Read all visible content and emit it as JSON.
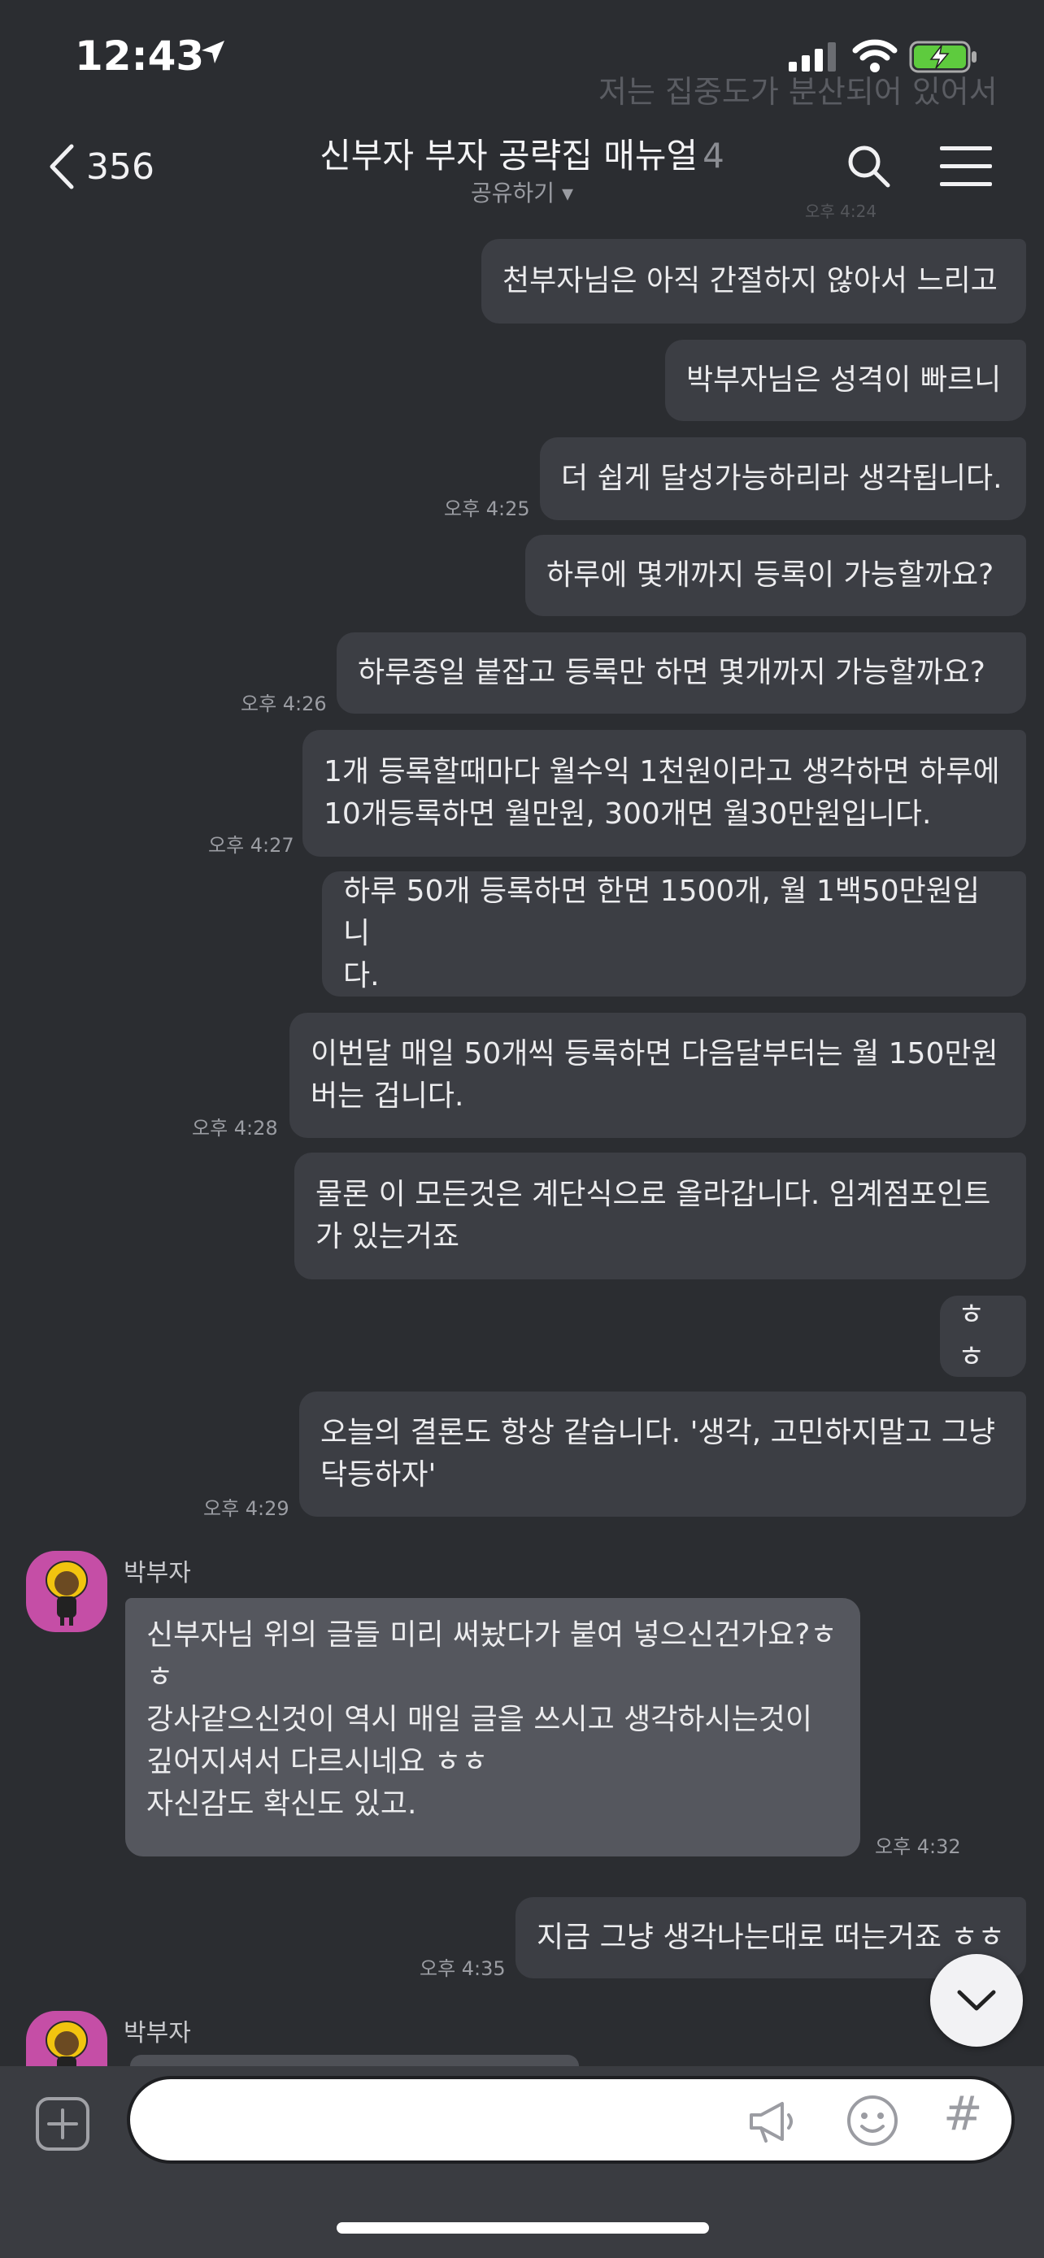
{
  "status": {
    "time": "12:43"
  },
  "ghost": {
    "text": "저는 집중도가 분산되어 있어서",
    "time": "오후 4:24"
  },
  "header": {
    "back_count": "356",
    "title": "신부자 부자 공략집 매뉴얼",
    "member_count": "4",
    "share_label": "공유하기 ▾"
  },
  "messages": [
    {
      "text": "천부자님은 아직 간절하지 않아서 느리고",
      "time": ""
    },
    {
      "text": "박부자님은 성격이 빠르니",
      "time": ""
    },
    {
      "text": "더 쉽게 달성가능하리라 생각됩니다.",
      "time": "오후 4:25"
    },
    {
      "text": "하루에 몇개까지 등록이 가능할까요?",
      "time": ""
    },
    {
      "text": "하루종일 붙잡고 등록만 하면 몇개까지 가능할까요?",
      "time": "오후 4:26"
    },
    {
      "text": "1개 등록할때마다 월수익 1천원이라고 생각하면 하루에\n10개등록하면 월만원, 300개면 월30만원입니다.",
      "time": "오후 4:27"
    },
    {
      "text": "하루 50개 등록하면 한면 1500개, 월 1백50만원입니\n다.",
      "time": ""
    },
    {
      "text": "이번달 매일 50개씩 등록하면 다음달부터는 월 150만원\n버는 겁니다.",
      "time": "오후 4:28"
    },
    {
      "text": "물론 이 모든것은 계단식으로 올라갑니다. 임계점포인트\n가 있는거죠",
      "time": ""
    },
    {
      "text": "ㅎㅎ",
      "time": ""
    },
    {
      "text": "오늘의 결론도 항상 같습니다. '생각, 고민하지말고 그냥\n닥등하자'",
      "time": "오후 4:29"
    }
  ],
  "incoming": {
    "sender": "박부자",
    "text": "신부자님 위의 글들 미리 써놨다가 붙여 넣으신건가요?ㅎ\nㅎ\n강사같으신것이 역시 매일 글을 쓰시고 생각하시는것이\n깊어지셔서 다르시네요 ㅎㅎ\n자신감도 확신도 있고.",
    "time": "오후 4:32"
  },
  "reply": {
    "text": "지금 그냥 생각나는대로 떠는거죠 ㅎㅎ",
    "time": "오후 4:35"
  },
  "incoming2": {
    "sender": "박부자"
  },
  "input": {
    "placeholder": ""
  },
  "icons": {
    "back": "chevron-left-icon",
    "search": "search-icon",
    "menu": "hamburger-menu-icon",
    "add": "plus-square-icon",
    "announce": "megaphone-icon",
    "emoji": "smiley-icon",
    "hashtag": "#",
    "scroll_down": "chevron-down-icon"
  },
  "colors": {
    "background": "#2b2d31",
    "my_bubble": "#3c3e44",
    "other_bubble": "#55575e",
    "avatar_bg": "#c54ea6",
    "battery": "#5ecb3e"
  }
}
